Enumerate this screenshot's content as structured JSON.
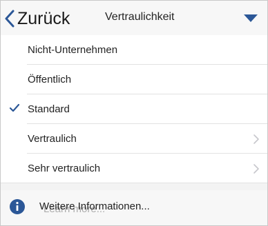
{
  "header": {
    "back_label": "Zurück",
    "title": "Vertraulichkeit",
    "back_icon": "chevron-left-icon",
    "dropdown_icon": "triangle-down-icon"
  },
  "list": {
    "items": [
      {
        "label": "Nicht-Unternehmen",
        "checked": false,
        "has_submenu": false
      },
      {
        "label": "Öffentlich",
        "checked": false,
        "has_submenu": false
      },
      {
        "label": "Standard",
        "checked": true,
        "has_submenu": false
      },
      {
        "label": "Vertraulich",
        "checked": false,
        "has_submenu": true
      },
      {
        "label": "Sehr vertraulich",
        "checked": false,
        "has_submenu": true
      }
    ]
  },
  "footer": {
    "label": "Weitere Informationen...",
    "ghost_label": "Learn more...",
    "icon": "info-icon"
  },
  "colors": {
    "accent": "#2b5797",
    "header_bg": "#f7f7f7",
    "divider": "#e2e2e2",
    "chevron": "#c7c7cc"
  }
}
